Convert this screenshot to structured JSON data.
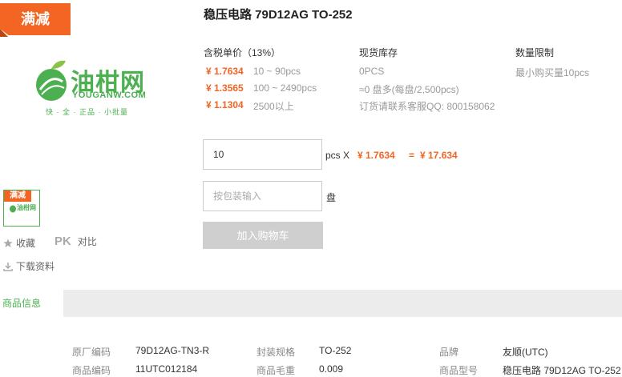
{
  "promo": {
    "label": "满减",
    "thumb_badge": "满减"
  },
  "logo": {
    "name": "油柑网",
    "domain": "YOUGANW.COM",
    "slogan": "快 · 全 · 正品 · 小批量",
    "thumb_text": "油柑网"
  },
  "product": {
    "title": "稳压电路 79D12AG TO-252"
  },
  "pricing": {
    "header": "含税单价（13%）",
    "tiers": [
      {
        "price": "¥ 1.7634",
        "range": "10 ~ 90pcs"
      },
      {
        "price": "¥ 1.3565",
        "range": "100 ~ 2490pcs"
      },
      {
        "price": "¥ 1.1304",
        "range": "2500以上"
      }
    ]
  },
  "stock": {
    "header": "现货库存",
    "quantity": "0PCS",
    "reels": "≈0 盘多(每盘/2,500pcs)",
    "contact": "订货请联系客服QQ: 800158062"
  },
  "limit": {
    "header": "数量限制",
    "value": "最小购买量10pcs"
  },
  "order": {
    "quantity_value": "10",
    "unit_label": "pcs X",
    "unit_price": "¥ 1.7634",
    "equals": "=",
    "total": "¥ 17.634",
    "pack_placeholder": "按包装输入",
    "pack_unit": "盘",
    "add_to_cart": "加入购物车"
  },
  "actions": {
    "favorite": "收藏",
    "pk_badge": "PK",
    "compare": "对比",
    "download": "下载资料"
  },
  "tabs": {
    "product_info": "商品信息"
  },
  "specs": [
    {
      "label": "原厂编码",
      "value": "79D12AG-TN3-R"
    },
    {
      "label": "封装规格",
      "value": "TO-252"
    },
    {
      "label": "品牌",
      "value": "友顺(UTC)"
    },
    {
      "label": "商品编码",
      "value": "11UTC012184"
    },
    {
      "label": "商品毛重",
      "value": "0.009"
    },
    {
      "label": "商品型号",
      "value": "稳压电路 79D12AG TO-252"
    }
  ],
  "colors": {
    "accent": "#f26522",
    "brand_green": "#4caf50"
  }
}
